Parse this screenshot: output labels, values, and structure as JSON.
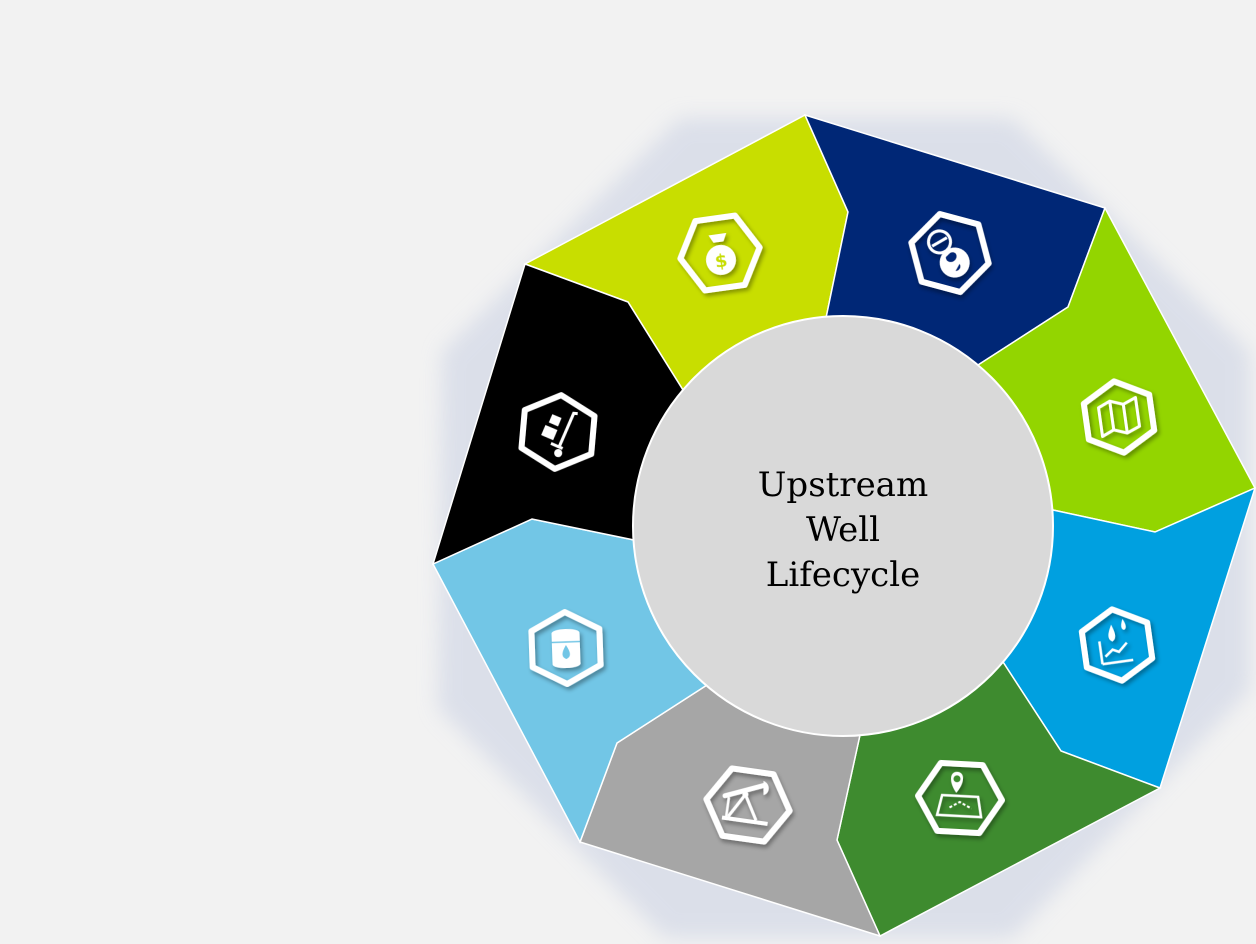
{
  "diagram": {
    "center": {
      "lines": [
        "Upstream",
        "Well",
        "Lifecycle"
      ],
      "fill": "#d9d9d9"
    },
    "segments": [
      {
        "key": "finance",
        "color": "#c8de00",
        "icon": "money-bag-icon"
      },
      {
        "key": "exploration",
        "color": "#002776",
        "icon": "compass-globe-icon"
      },
      {
        "key": "mapping",
        "color": "#93d500",
        "icon": "map-icon"
      },
      {
        "key": "reservoir",
        "color": "#00a0e0",
        "icon": "oil-drops-chart-icon"
      },
      {
        "key": "site",
        "color": "#3e8b2f",
        "icon": "location-map-icon"
      },
      {
        "key": "production",
        "color": "#a6a6a6",
        "icon": "pump-jack-icon"
      },
      {
        "key": "storage",
        "color": "#72c6e6",
        "icon": "oil-barrel-icon"
      },
      {
        "key": "logistics",
        "color": "#000000",
        "icon": "hand-truck-icon"
      }
    ]
  }
}
